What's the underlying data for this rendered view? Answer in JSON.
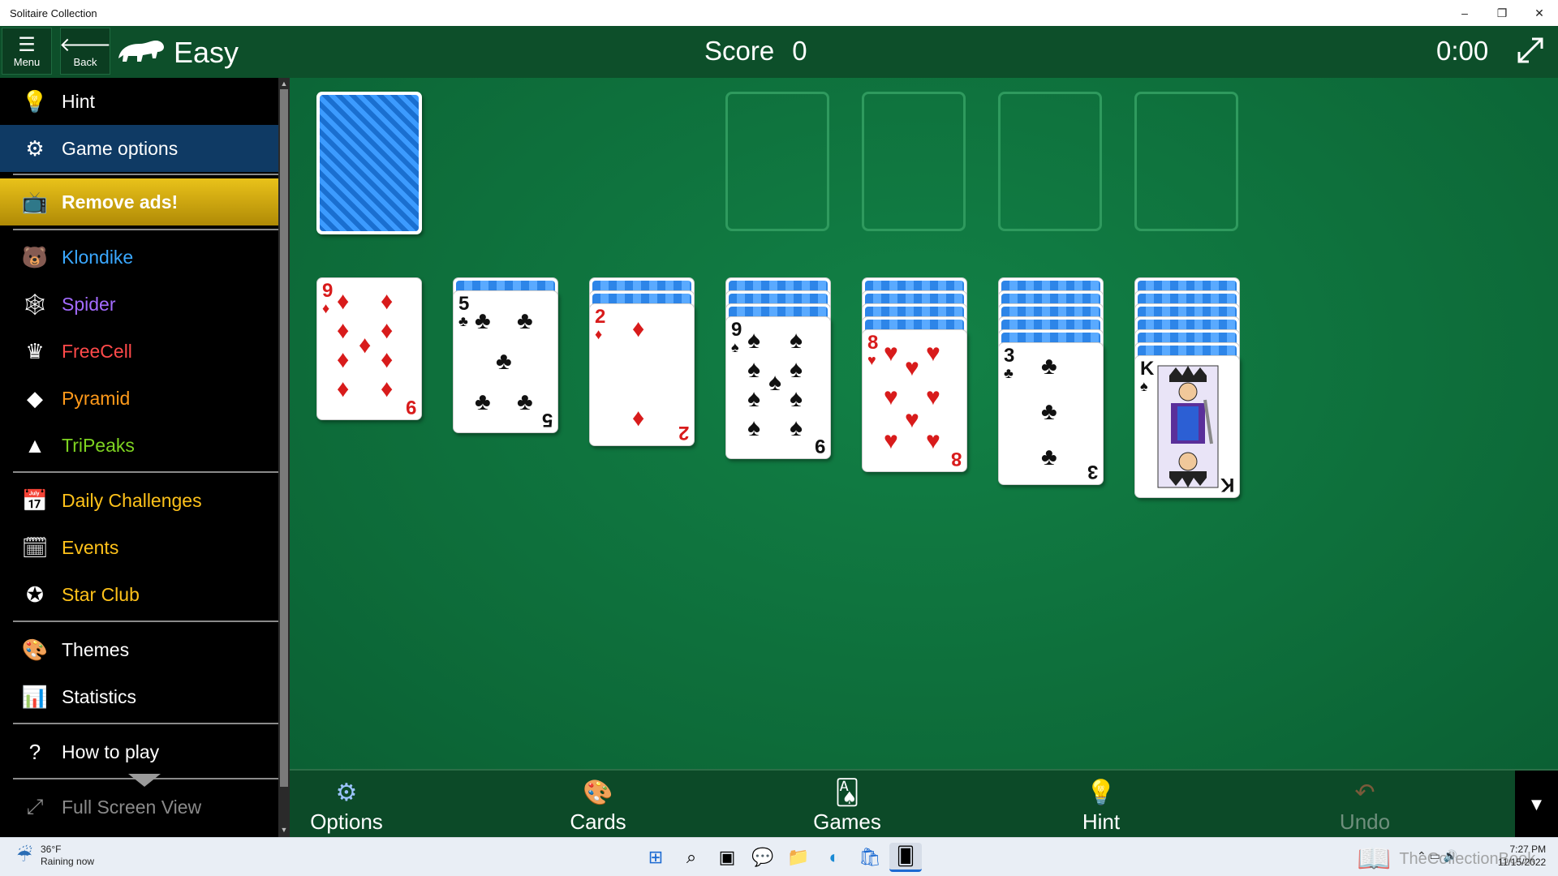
{
  "window": {
    "title": "Solitaire Collection",
    "controls": {
      "minimize": "–",
      "restore": "❐",
      "close": "✕"
    }
  },
  "header": {
    "menu_label": "Menu",
    "back_label": "Back",
    "level": "Easy",
    "score_label": "Score",
    "score_value": "0",
    "timer": "0:00",
    "icons": {
      "menu": "hamburger-icon",
      "back": "back-arrow-icon",
      "game": "polar-bear-icon",
      "expand": "expand-icon"
    }
  },
  "sidebar": {
    "items": [
      {
        "label": "Hint",
        "icon": "lightbulb-icon",
        "color": "#ffffff"
      },
      {
        "label": "Game options",
        "icon": "gear-icon",
        "color": "#ffffff",
        "selected": true
      },
      {
        "label": "Remove ads!",
        "icon": "tv-icon",
        "color": "#ffffff"
      },
      {
        "label": "Klondike",
        "icon": "polar-bear-icon",
        "color": "#3aa8ff"
      },
      {
        "label": "Spider",
        "icon": "spider-icon",
        "color": "#a36bff"
      },
      {
        "label": "FreeCell",
        "icon": "crown-icon",
        "color": "#ff4a4a"
      },
      {
        "label": "Pyramid",
        "icon": "pyramid-icon",
        "color": "#ff9a1a"
      },
      {
        "label": "TriPeaks",
        "icon": "mountain-icon",
        "color": "#7ed321"
      },
      {
        "label": "Daily Challenges",
        "icon": "calendar-icon",
        "color": "#ffc21a"
      },
      {
        "label": "Events",
        "icon": "events-calendar-icon",
        "color": "#ffc21a"
      },
      {
        "label": "Star Club",
        "icon": "star-club-icon",
        "color": "#ffc21a"
      },
      {
        "label": "Themes",
        "icon": "palette-icon",
        "color": "#ffffff"
      },
      {
        "label": "Statistics",
        "icon": "bar-chart-icon",
        "color": "#ffffff"
      },
      {
        "label": "How to play",
        "icon": "question-icon",
        "color": "#ffffff"
      },
      {
        "label": "Full Screen View",
        "icon": "fullscreen-icon",
        "color": "#8a8a8a"
      }
    ]
  },
  "board": {
    "stock": "card-back",
    "foundations": 4,
    "tableau": [
      {
        "hidden": 0,
        "rank": "9",
        "suit": "♦",
        "color": "red"
      },
      {
        "hidden": 1,
        "rank": "5",
        "suit": "♣",
        "color": "black"
      },
      {
        "hidden": 2,
        "rank": "2",
        "suit": "♦",
        "color": "red"
      },
      {
        "hidden": 3,
        "rank": "9",
        "suit": "♠",
        "color": "black"
      },
      {
        "hidden": 4,
        "rank": "8",
        "suit": "♥",
        "color": "red"
      },
      {
        "hidden": 5,
        "rank": "3",
        "suit": "♣",
        "color": "black"
      },
      {
        "hidden": 6,
        "rank": "K",
        "suit": "♠",
        "color": "black"
      }
    ]
  },
  "bottombar": {
    "options": "Options",
    "cards": "Cards",
    "games": "Games",
    "hint": "Hint",
    "undo": "Undo",
    "more_icon": "chevron-down-icon"
  },
  "taskbar": {
    "weather_temp": "36°F",
    "weather_desc": "Raining now",
    "time": "7:27 PM",
    "date": "11/15/2022",
    "watermark": "TheCollectionBook"
  },
  "colors": {
    "felt": "#0d6b39",
    "header": "#0d4f2a",
    "selected": "#0f3a64",
    "ads": "#e9c21a"
  }
}
